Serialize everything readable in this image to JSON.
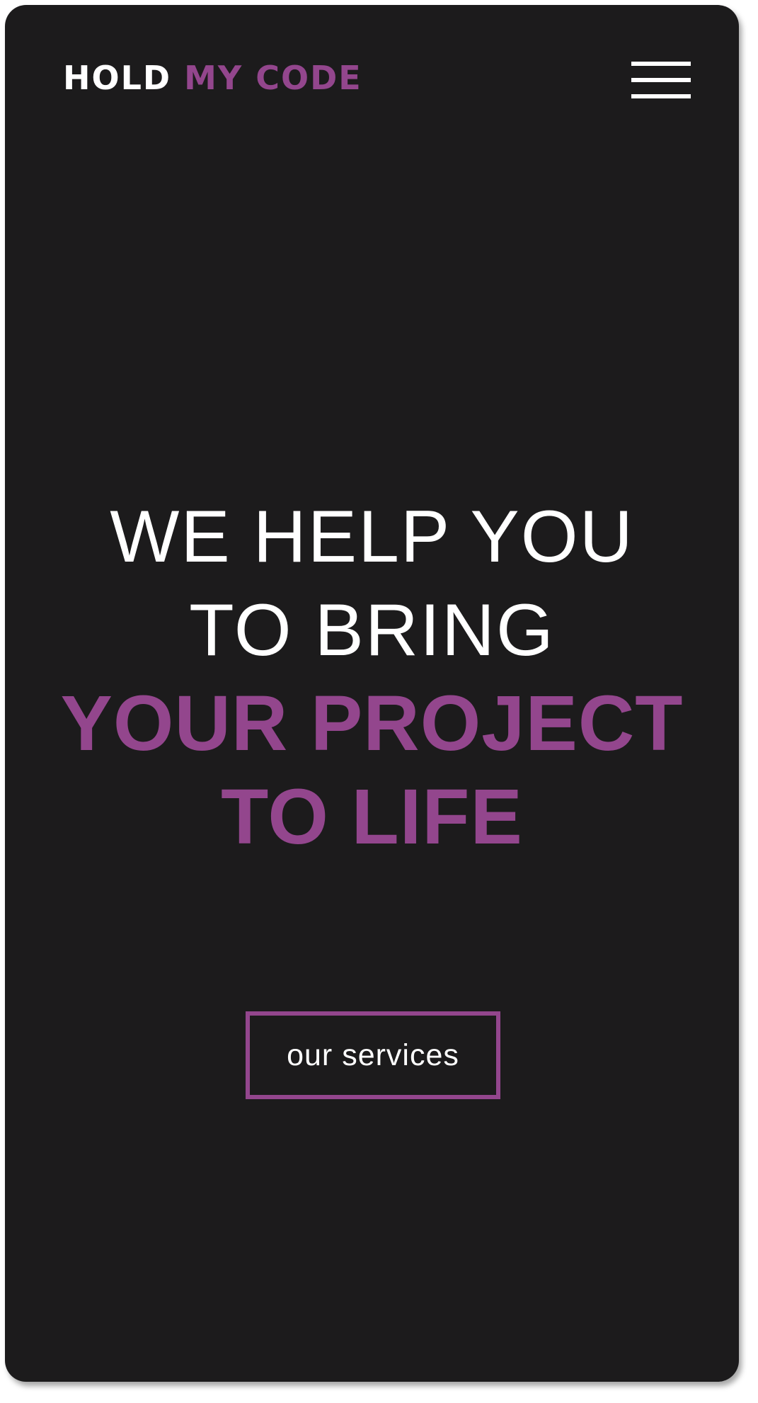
{
  "colors": {
    "background": "#1c1b1c",
    "accent": "#93468d",
    "text": "#ffffff"
  },
  "header": {
    "logo": {
      "word1": "HOLD",
      "word2": "MY",
      "word3": "CODE"
    },
    "menu_icon": "hamburger-menu-icon"
  },
  "hero": {
    "line1": "WE HELP YOU",
    "line2": "TO BRING",
    "line3": "YOUR PROJECT",
    "line4": "TO LIFE"
  },
  "cta": {
    "label": "our services"
  }
}
